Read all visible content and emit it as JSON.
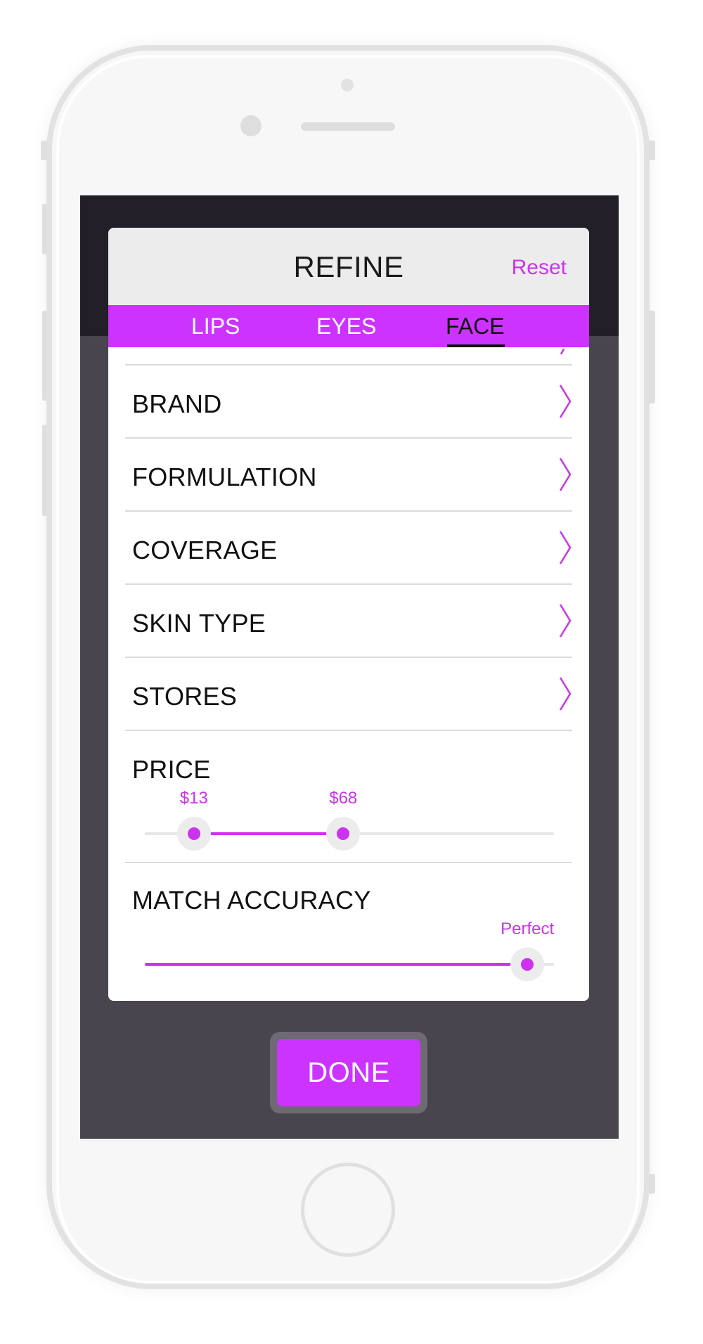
{
  "modal": {
    "title": "REFINE",
    "reset_label": "Reset"
  },
  "tabs": [
    {
      "label": "LIPS",
      "active": false
    },
    {
      "label": "EYES",
      "active": false
    },
    {
      "label": "FACE",
      "active": true
    }
  ],
  "filters": [
    {
      "label": "BRAND",
      "icon": "chevron-right-icon"
    },
    {
      "label": "FORMULATION",
      "icon": "chevron-right-icon"
    },
    {
      "label": "COVERAGE",
      "icon": "chevron-right-icon"
    },
    {
      "label": "SKIN TYPE",
      "icon": "chevron-right-icon"
    },
    {
      "label": "STORES",
      "icon": "chevron-right-icon"
    }
  ],
  "price": {
    "label": "PRICE",
    "min_label": "$13",
    "max_label": "$68",
    "min_fraction": 0.12,
    "max_fraction": 0.485
  },
  "match_accuracy": {
    "label": "MATCH ACCURACY",
    "value_label": "Perfect",
    "fraction": 0.935
  },
  "done_label": "DONE",
  "colors": {
    "accent": "#cc33ff",
    "accent_text": "#cc33ee",
    "overlay": "#48454f"
  }
}
